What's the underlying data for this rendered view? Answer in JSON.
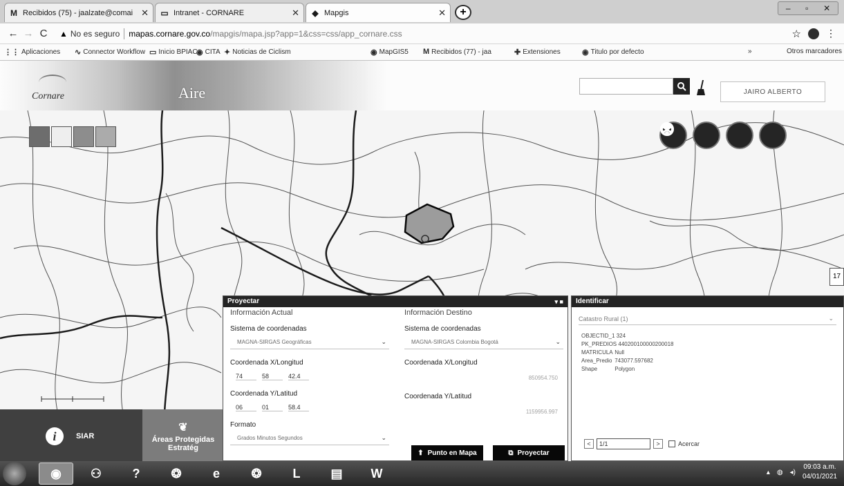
{
  "browser": {
    "tabs": [
      {
        "icon": "gmail-icon",
        "label": "Recibidos (75) - jaalzate@comai"
      },
      {
        "icon": "page-icon",
        "label": "Intranet - CORNARE"
      },
      {
        "icon": "mapgis-icon",
        "label": "Mapgis"
      }
    ],
    "security_label": "No es seguro",
    "url_domain": "mapas.cornare.gov.co",
    "url_path": "/mapgis/mapa.jsp?app=1&css=css/app_cornare.css",
    "bookmarks": [
      {
        "icon": "apps-icon",
        "label": "Aplicaciones"
      },
      {
        "icon": "link-icon",
        "label": "Connector Workflow"
      },
      {
        "icon": "page-icon",
        "label": "Inicio BPIAC"
      },
      {
        "icon": "globe-icon",
        "label": "CITA"
      },
      {
        "icon": "news-icon",
        "label": "Noticias de Ciclism"
      },
      {
        "icon": "globe-icon",
        "label": "MapGIS5"
      },
      {
        "icon": "gmail-icon",
        "label": "Recibidos (77) - jaa"
      },
      {
        "icon": "puzzle-icon",
        "label": "Extensiones"
      },
      {
        "icon": "globe-icon",
        "label": "Titulo por defecto"
      },
      {
        "icon": "more-icon",
        "label": "»"
      },
      {
        "icon": "folder-icon",
        "label": "Otros marcadores"
      }
    ]
  },
  "app": {
    "logo_text": "Cornare",
    "section_title": "Aire",
    "search_placeholder": "",
    "user_label": "JAIRO ALBERTO",
    "zoom_level": "17"
  },
  "docked": {
    "siar_label": "SIAR",
    "areas_label_1": "Áreas Protegidas",
    "areas_label_2": "Estratég"
  },
  "proyectar": {
    "title": "Proyectar",
    "actual": {
      "heading": "Información Actual",
      "system_label": "Sistema de coordenadas",
      "system_value": "MAGNA-SIRGAS Geográficas",
      "x_label": "Coordenada X/Longitud",
      "x_deg": "74",
      "x_min": "58",
      "x_sec": "42.4",
      "y_label": "Coordenada Y/Latitud",
      "y_deg": "06",
      "y_min": "01",
      "y_sec": "58.4",
      "format_label": "Formato",
      "format_value": "Grados Minutos Segundos"
    },
    "destino": {
      "heading": "Información Destino",
      "system_label": "Sistema de coordenadas",
      "system_value": "MAGNA-SIRGAS Colombia Bogotá",
      "x_label": "Coordenada X/Longitud",
      "x_value": "850954.750",
      "y_label": "Coordenada Y/Latitud",
      "y_value": "1159956.997"
    },
    "btn_punto": "Punto en Mapa",
    "btn_proyectar": "Proyectar"
  },
  "identificar": {
    "title": "Identificar",
    "layer": "Catastro Rural (1)",
    "attributes": [
      {
        "key": "OBJECTID_1",
        "value": "324"
      },
      {
        "key": "PK_PREDIOS",
        "value": "440200100000200018"
      },
      {
        "key": "MATRICULA",
        "value": "Null"
      },
      {
        "key": "Area_Predio",
        "value": "743077.597682"
      },
      {
        "key": "Shape",
        "value": "Polygon"
      }
    ],
    "page": "1/1",
    "acercar_label": "Acercar"
  },
  "taskbar": {
    "time": "09:03 a.m.",
    "date": "04/01/2021"
  }
}
